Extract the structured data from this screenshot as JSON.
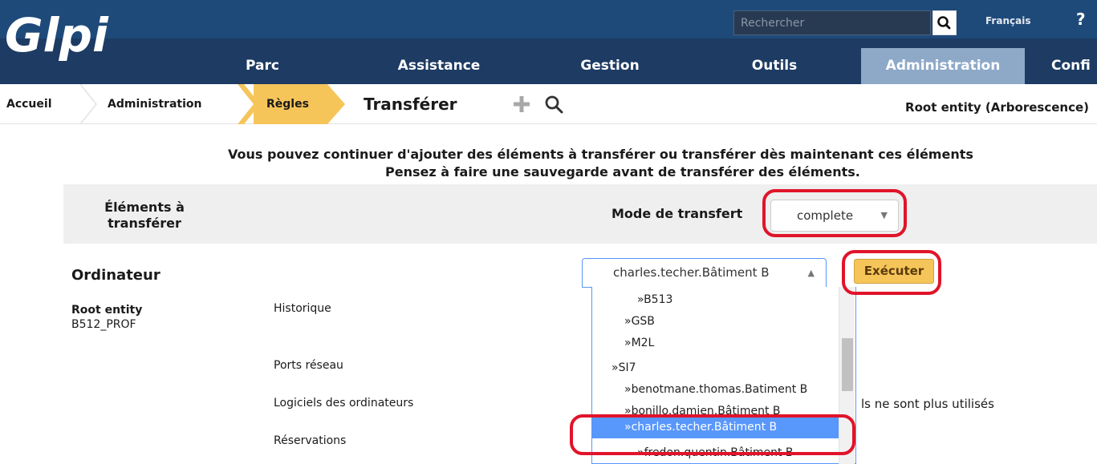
{
  "header": {
    "logo_text": "Glpi",
    "search_placeholder": "Rechercher",
    "language": "Français",
    "help": "?"
  },
  "menu": [
    "Parc",
    "Assistance",
    "Gestion",
    "Outils",
    "Administration",
    "Confi"
  ],
  "breadcrumb": {
    "home": "Accueil",
    "admin": "Administration",
    "rules": "Règles",
    "title": "Transférer"
  },
  "entity": "Root entity (Arborescence)",
  "messages": {
    "line1": "Vous pouvez continuer d'ajouter des éléments à transférer ou transférer dès maintenant ces éléments",
    "line2": "Pensez à faire une sauvegarde avant de transférer des éléments."
  },
  "table": {
    "col1_line1": "Éléments à",
    "col1_line2": "transférer",
    "mode_label": "Mode de transfert",
    "mode_value": "complete"
  },
  "item": {
    "type": "Ordinateur",
    "entity": "Root entity",
    "name": "B512_PROF",
    "options": [
      "Historique",
      "Ports réseau",
      "Logiciels des ordinateurs",
      "Réservations"
    ],
    "software_msg": "ls ne sont plus utilisés"
  },
  "owner_dropdown": {
    "selected": "charles.techer.Bâtiment B",
    "options": [
      "»B513",
      "»GSB",
      "»M2L",
      "»SI7",
      "»benotmane.thomas.Batiment B",
      "»bonillo.damien.Bâtiment B",
      "»charles.techer.Bâtiment B",
      "»fredon.quentin.Bâtiment B"
    ],
    "highlighted_index": 6
  },
  "execute_label": "Exécuter",
  "colors": {
    "header_bg": "#1d3b63",
    "active_menu": "#8ea9c8",
    "crumb_active": "#f6c55a",
    "highlight": "#5897fb",
    "annotation": "#e0142a"
  }
}
